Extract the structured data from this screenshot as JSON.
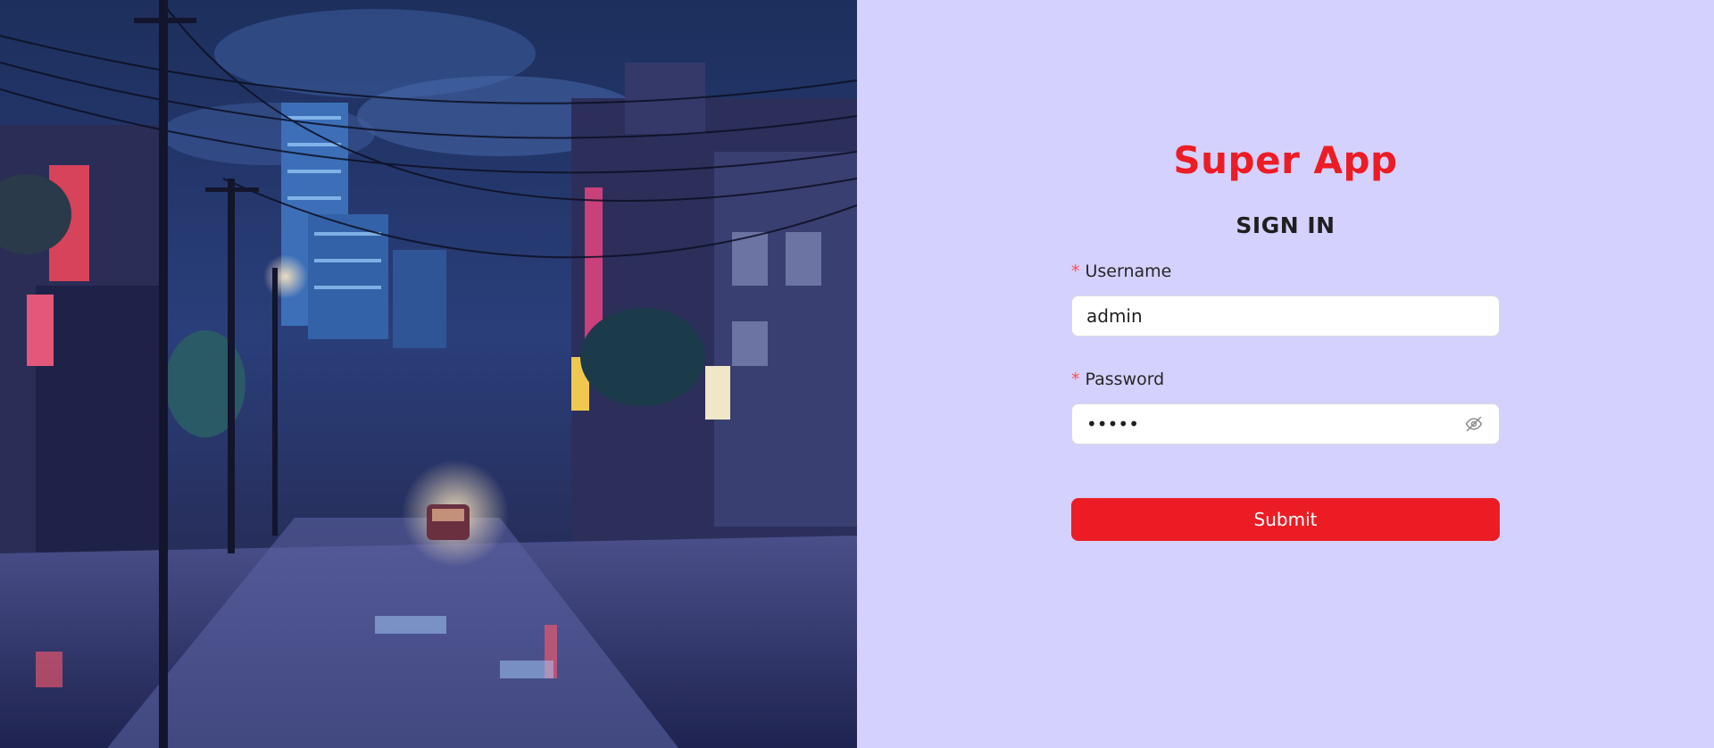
{
  "brand": {
    "app_title": "Super App",
    "accent_color": "#ec1c24",
    "panel_background": "#d4d1ff"
  },
  "hero": {
    "description_icon": "night-street-illustration"
  },
  "form": {
    "heading": "SIGN IN",
    "required_mark": "*",
    "username": {
      "label": "Username",
      "value": "admin"
    },
    "password": {
      "label": "Password",
      "value": "•••••",
      "toggle_icon": "eye-slash-icon"
    },
    "submit_label": "Submit"
  }
}
